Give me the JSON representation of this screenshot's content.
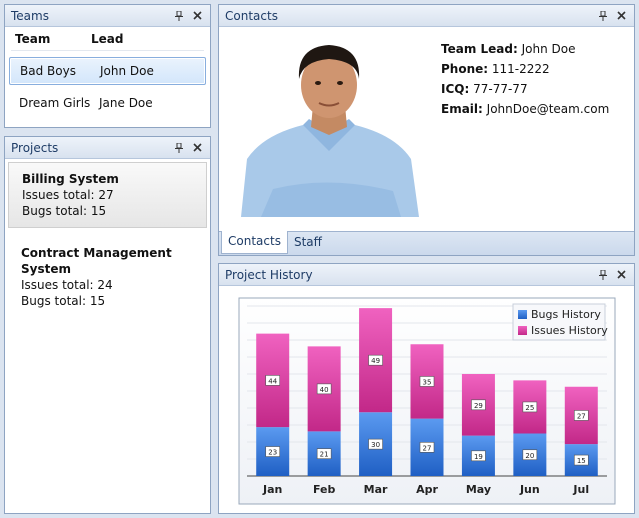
{
  "teams": {
    "title": "Teams",
    "columns": [
      "Team",
      "Lead"
    ],
    "rows": [
      {
        "team": "Bad Boys",
        "lead": "John Doe"
      },
      {
        "team": "Dream Girls",
        "lead": "Jane Doe"
      }
    ]
  },
  "projects": {
    "title": "Projects",
    "items": [
      {
        "name": "Billing System",
        "issues": "Issues total: 27",
        "bugs": "Bugs total: 15"
      },
      {
        "name": "Contract Management System",
        "issues": "Issues total: 24",
        "bugs": "Bugs total: 15"
      }
    ]
  },
  "contacts": {
    "title": "Contacts",
    "lead_label": "Team Lead:",
    "lead": "John Doe",
    "phone_label": "Phone:",
    "phone": "111-2222",
    "icq_label": "ICQ:",
    "icq": "77-77-77",
    "email_label": "Email:",
    "email": "JohnDoe@team.com",
    "tabs": [
      "Contacts",
      "Staff"
    ]
  },
  "history": {
    "title": "Project History"
  },
  "colors": {
    "bugs": "#3b7fd9",
    "issues": "#d6359e"
  },
  "icons": {
    "pin": "pin-icon",
    "close": "close-icon"
  },
  "chart_data": {
    "type": "bar",
    "stacked": true,
    "categories": [
      "Jan",
      "Feb",
      "Mar",
      "Apr",
      "May",
      "Jun",
      "Jul"
    ],
    "series": [
      {
        "name": "Bugs History",
        "values": [
          23,
          21,
          30,
          27,
          19,
          20,
          15
        ]
      },
      {
        "name": "Issues History",
        "values": [
          44,
          40,
          49,
          35,
          29,
          25,
          27
        ]
      }
    ],
    "title": "",
    "xlabel": "",
    "ylabel": "",
    "ylim": [
      0,
      80
    ],
    "grid": true,
    "legend": "top-right"
  }
}
